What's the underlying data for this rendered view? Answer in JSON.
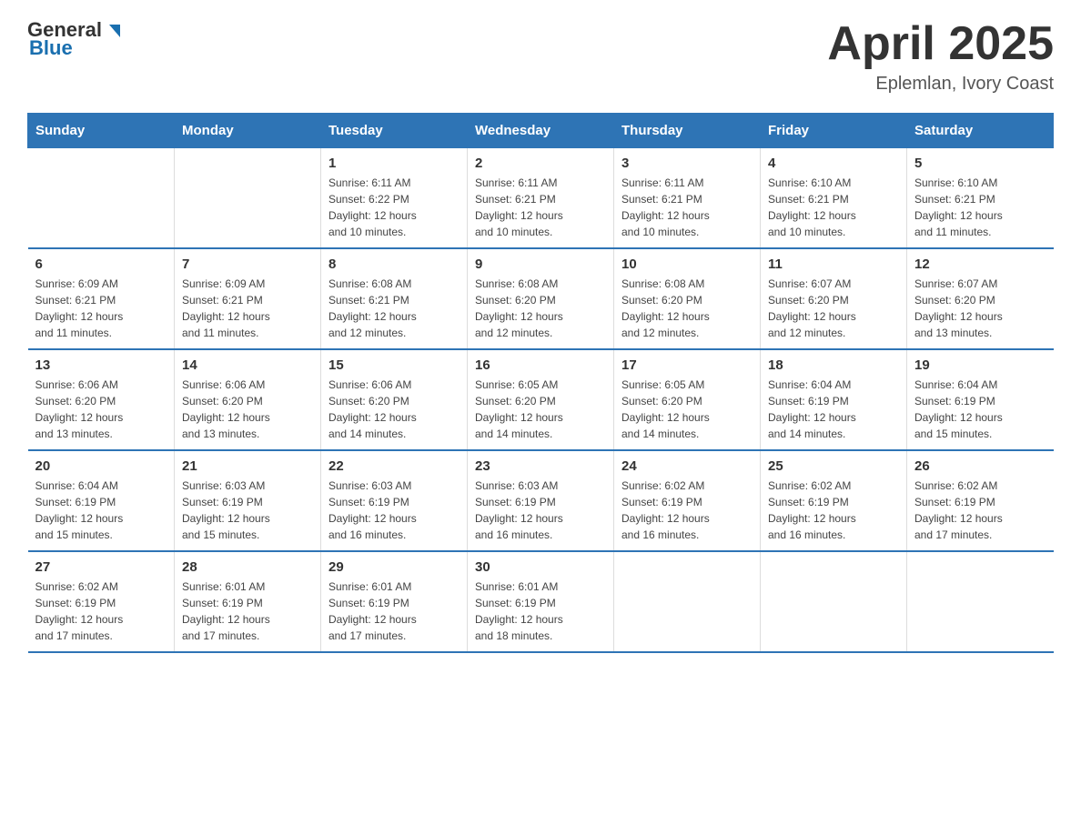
{
  "logo": {
    "general": "General",
    "blue": "Blue"
  },
  "header": {
    "month": "April 2025",
    "location": "Eplemlan, Ivory Coast"
  },
  "weekdays": [
    "Sunday",
    "Monday",
    "Tuesday",
    "Wednesday",
    "Thursday",
    "Friday",
    "Saturday"
  ],
  "weeks": [
    [
      {
        "day": "",
        "info": ""
      },
      {
        "day": "",
        "info": ""
      },
      {
        "day": "1",
        "info": "Sunrise: 6:11 AM\nSunset: 6:22 PM\nDaylight: 12 hours\nand 10 minutes."
      },
      {
        "day": "2",
        "info": "Sunrise: 6:11 AM\nSunset: 6:21 PM\nDaylight: 12 hours\nand 10 minutes."
      },
      {
        "day": "3",
        "info": "Sunrise: 6:11 AM\nSunset: 6:21 PM\nDaylight: 12 hours\nand 10 minutes."
      },
      {
        "day": "4",
        "info": "Sunrise: 6:10 AM\nSunset: 6:21 PM\nDaylight: 12 hours\nand 10 minutes."
      },
      {
        "day": "5",
        "info": "Sunrise: 6:10 AM\nSunset: 6:21 PM\nDaylight: 12 hours\nand 11 minutes."
      }
    ],
    [
      {
        "day": "6",
        "info": "Sunrise: 6:09 AM\nSunset: 6:21 PM\nDaylight: 12 hours\nand 11 minutes."
      },
      {
        "day": "7",
        "info": "Sunrise: 6:09 AM\nSunset: 6:21 PM\nDaylight: 12 hours\nand 11 minutes."
      },
      {
        "day": "8",
        "info": "Sunrise: 6:08 AM\nSunset: 6:21 PM\nDaylight: 12 hours\nand 12 minutes."
      },
      {
        "day": "9",
        "info": "Sunrise: 6:08 AM\nSunset: 6:20 PM\nDaylight: 12 hours\nand 12 minutes."
      },
      {
        "day": "10",
        "info": "Sunrise: 6:08 AM\nSunset: 6:20 PM\nDaylight: 12 hours\nand 12 minutes."
      },
      {
        "day": "11",
        "info": "Sunrise: 6:07 AM\nSunset: 6:20 PM\nDaylight: 12 hours\nand 12 minutes."
      },
      {
        "day": "12",
        "info": "Sunrise: 6:07 AM\nSunset: 6:20 PM\nDaylight: 12 hours\nand 13 minutes."
      }
    ],
    [
      {
        "day": "13",
        "info": "Sunrise: 6:06 AM\nSunset: 6:20 PM\nDaylight: 12 hours\nand 13 minutes."
      },
      {
        "day": "14",
        "info": "Sunrise: 6:06 AM\nSunset: 6:20 PM\nDaylight: 12 hours\nand 13 minutes."
      },
      {
        "day": "15",
        "info": "Sunrise: 6:06 AM\nSunset: 6:20 PM\nDaylight: 12 hours\nand 14 minutes."
      },
      {
        "day": "16",
        "info": "Sunrise: 6:05 AM\nSunset: 6:20 PM\nDaylight: 12 hours\nand 14 minutes."
      },
      {
        "day": "17",
        "info": "Sunrise: 6:05 AM\nSunset: 6:20 PM\nDaylight: 12 hours\nand 14 minutes."
      },
      {
        "day": "18",
        "info": "Sunrise: 6:04 AM\nSunset: 6:19 PM\nDaylight: 12 hours\nand 14 minutes."
      },
      {
        "day": "19",
        "info": "Sunrise: 6:04 AM\nSunset: 6:19 PM\nDaylight: 12 hours\nand 15 minutes."
      }
    ],
    [
      {
        "day": "20",
        "info": "Sunrise: 6:04 AM\nSunset: 6:19 PM\nDaylight: 12 hours\nand 15 minutes."
      },
      {
        "day": "21",
        "info": "Sunrise: 6:03 AM\nSunset: 6:19 PM\nDaylight: 12 hours\nand 15 minutes."
      },
      {
        "day": "22",
        "info": "Sunrise: 6:03 AM\nSunset: 6:19 PM\nDaylight: 12 hours\nand 16 minutes."
      },
      {
        "day": "23",
        "info": "Sunrise: 6:03 AM\nSunset: 6:19 PM\nDaylight: 12 hours\nand 16 minutes."
      },
      {
        "day": "24",
        "info": "Sunrise: 6:02 AM\nSunset: 6:19 PM\nDaylight: 12 hours\nand 16 minutes."
      },
      {
        "day": "25",
        "info": "Sunrise: 6:02 AM\nSunset: 6:19 PM\nDaylight: 12 hours\nand 16 minutes."
      },
      {
        "day": "26",
        "info": "Sunrise: 6:02 AM\nSunset: 6:19 PM\nDaylight: 12 hours\nand 17 minutes."
      }
    ],
    [
      {
        "day": "27",
        "info": "Sunrise: 6:02 AM\nSunset: 6:19 PM\nDaylight: 12 hours\nand 17 minutes."
      },
      {
        "day": "28",
        "info": "Sunrise: 6:01 AM\nSunset: 6:19 PM\nDaylight: 12 hours\nand 17 minutes."
      },
      {
        "day": "29",
        "info": "Sunrise: 6:01 AM\nSunset: 6:19 PM\nDaylight: 12 hours\nand 17 minutes."
      },
      {
        "day": "30",
        "info": "Sunrise: 6:01 AM\nSunset: 6:19 PM\nDaylight: 12 hours\nand 18 minutes."
      },
      {
        "day": "",
        "info": ""
      },
      {
        "day": "",
        "info": ""
      },
      {
        "day": "",
        "info": ""
      }
    ]
  ]
}
